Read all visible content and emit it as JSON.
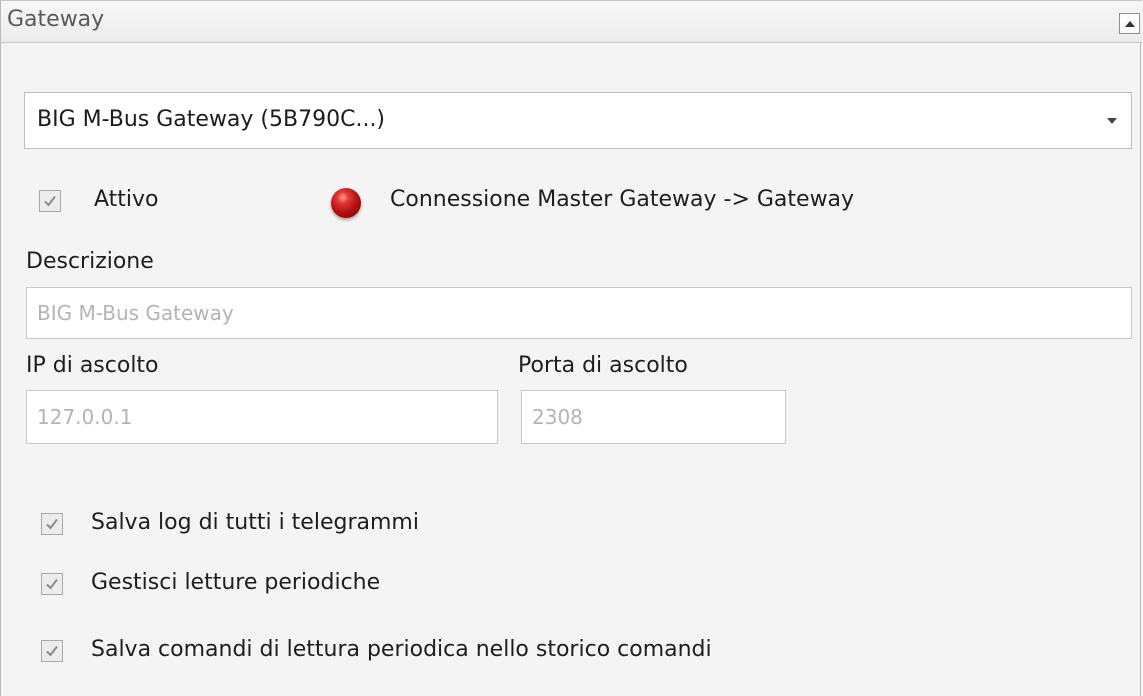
{
  "panel": {
    "title": "Gateway"
  },
  "gateway_select": {
    "value": "BIG M-Bus Gateway (5B790C...)"
  },
  "attivo": {
    "label": "Attivo",
    "checked": true
  },
  "connection_status": {
    "label": "Connessione Master Gateway -> Gateway",
    "color": "#c0141a"
  },
  "descrizione": {
    "label": "Descrizione",
    "value": "BIG M-Bus Gateway"
  },
  "ip": {
    "label": "IP di ascolto",
    "value": "127.0.0.1"
  },
  "porta": {
    "label": "Porta di ascolto",
    "value": "2308"
  },
  "options": [
    {
      "label": "Salva log di tutti i telegrammi",
      "checked": true
    },
    {
      "label": "Gestisci letture periodiche",
      "checked": true
    },
    {
      "label": "Salva comandi di lettura periodica nello storico comandi",
      "checked": true
    }
  ]
}
